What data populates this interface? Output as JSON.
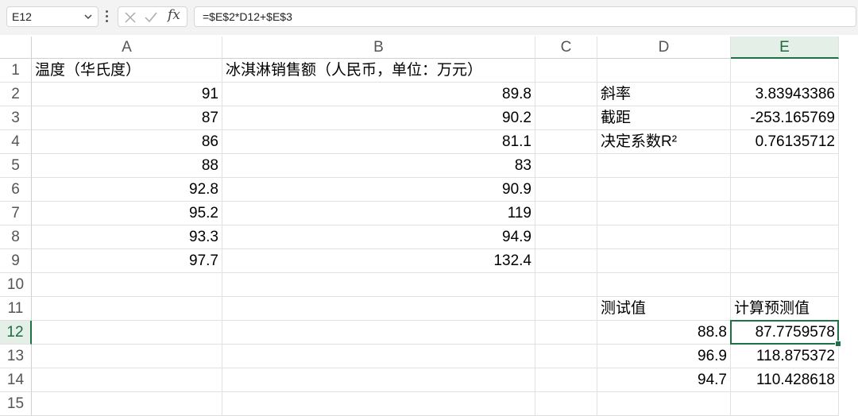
{
  "formula_bar": {
    "name_box": "E12",
    "formula": "=$E$2*D12+$E$3",
    "fx_label": "fx",
    "icons": [
      "chevron-down-icon",
      "more-vertical-icon",
      "cancel-icon",
      "confirm-icon",
      "function-icon"
    ]
  },
  "columns": [
    "A",
    "B",
    "C",
    "D",
    "E"
  ],
  "rows": [
    "1",
    "2",
    "3",
    "4",
    "5",
    "6",
    "7",
    "8",
    "9",
    "10",
    "11",
    "12",
    "13",
    "14",
    "15"
  ],
  "active_cell": "E12",
  "cells": {
    "A1": "温度（华氏度）",
    "B1": "冰淇淋销售额（人民币，单位：万元）",
    "A2": "91",
    "B2": "89.8",
    "A3": "87",
    "B3": "90.2",
    "A4": "86",
    "B4": "81.1",
    "A5": "88",
    "B5": "83",
    "A6": "92.8",
    "B6": "90.9",
    "A7": "95.2",
    "B7": "119",
    "A8": "93.3",
    "B8": "94.9",
    "A9": "97.7",
    "B9": "132.4",
    "D2": "斜率",
    "E2": "3.83943386",
    "D3": "截距",
    "E3": "-253.165769",
    "D4": "决定系数R²",
    "E4": "0.76135712",
    "D11": "测试值",
    "E11": "计算预测值",
    "D12": "88.8",
    "E12": "87.7759578",
    "D13": "96.9",
    "E13": "118.875372",
    "D14": "94.7",
    "E14": "110.428618"
  },
  "colors": {
    "accent": "#1e7145",
    "header_active_bg": "#e3efe7",
    "gridline": "#e1e1e1"
  }
}
